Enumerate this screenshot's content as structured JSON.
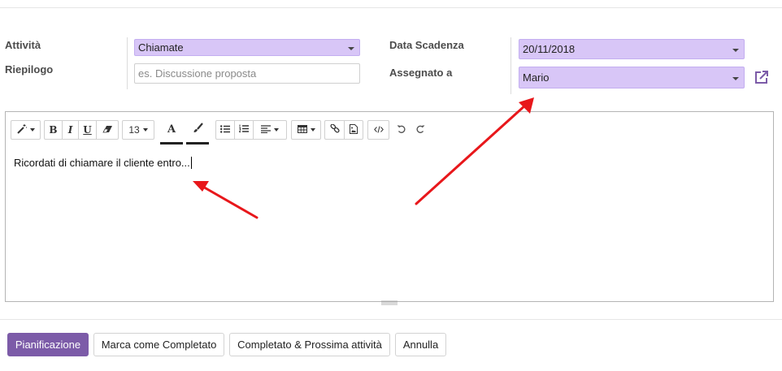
{
  "form": {
    "activity_label": "Attività",
    "activity_value": "Chiamate",
    "summary_label": "Riepilogo",
    "summary_placeholder": "es. Discussione proposta",
    "due_date_label": "Data Scadenza",
    "due_date_value": "20/11/2018",
    "assigned_label": "Assegnato a",
    "assigned_value": "Mario"
  },
  "toolbar": {
    "font_size": "13",
    "bold": "B",
    "italic": "I",
    "underline": "U",
    "font_color_glyph": "A"
  },
  "editor": {
    "content": "Ricordati di chiamare il cliente entro..."
  },
  "buttons": {
    "schedule": "Pianificazione",
    "mark_done": "Marca come Completato",
    "done_next": "Completato & Prossima attività",
    "cancel": "Annulla"
  },
  "colors": {
    "primary": "#7c5ba8",
    "select_bg": "#d8c6f7",
    "annotation_arrow": "#e8171b"
  }
}
